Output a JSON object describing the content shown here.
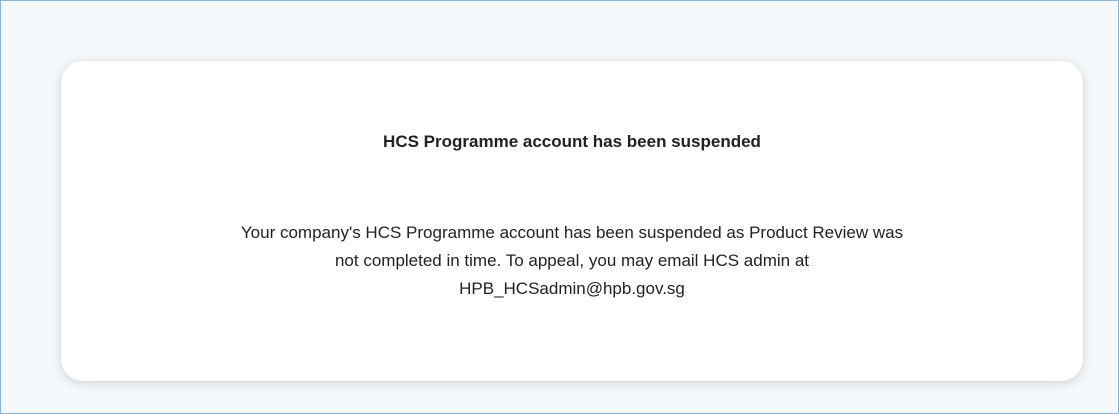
{
  "dialog": {
    "title": "HCS Programme account has been suspended",
    "message_lines": [
      "Your company's HCS Programme account has been suspended as Product Review was",
      "not completed in time. To appeal, you may email HCS admin at",
      "HPB_HCSadmin@hpb.gov.sg"
    ]
  },
  "colors": {
    "page_background": "#f5f8fb",
    "frame_border": "#8ab4d8",
    "card_background": "#ffffff",
    "text": "#222222"
  }
}
